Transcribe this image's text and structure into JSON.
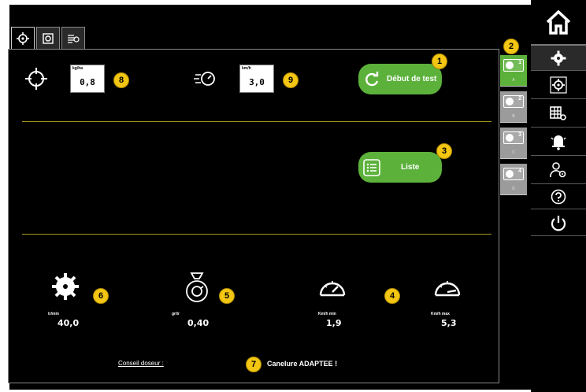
{
  "tabs": [
    {
      "name": "test-tab",
      "icon": "crosshair-icon",
      "active": true
    },
    {
      "name": "camera-tab",
      "icon": "photo-icon",
      "active": false
    },
    {
      "name": "brush-tab",
      "icon": "brush-icon",
      "active": false
    }
  ],
  "top_row": {
    "rate": {
      "unit": "kg/ha",
      "value": "0,8",
      "badge": "8"
    },
    "speed": {
      "unit": "km/h",
      "value": "3,0",
      "badge": "9"
    },
    "start_button": {
      "label": "Début de test",
      "badge": "1"
    }
  },
  "list_button": {
    "label": "Liste",
    "badge": "3"
  },
  "dose_strip": {
    "badge": "2",
    "items": [
      {
        "number": "1",
        "letter": "A",
        "active": true
      },
      {
        "number": "2",
        "letter": "B",
        "active": false
      },
      {
        "number": "3",
        "letter": "C",
        "active": false
      },
      {
        "number": "4",
        "letter": "D",
        "active": false
      }
    ]
  },
  "stats": {
    "trmin": {
      "label": "tr/min",
      "value": "40,0",
      "badge": "6"
    },
    "grtr": {
      "label": "gr/tr",
      "value": "0,40",
      "badge": "5"
    },
    "kmh_min": {
      "label": "Km/h min",
      "value": "1,9"
    },
    "kmh_max": {
      "label": "Km/h max",
      "value": "5,3"
    },
    "kmh_badge": "4"
  },
  "advice": {
    "label": "Conseil doseur :",
    "message": "Canelure ADAPTEE !",
    "badge": "7"
  },
  "colors": {
    "accent_green": "#5cb13b",
    "badge_yellow": "#f3c613",
    "divider_olive": "#a89a1c",
    "strip_grey": "#9b9b9b"
  },
  "sidebar": [
    "home-icon",
    "gear-icon",
    "crosshair-icon",
    "grid-settings-icon",
    "bell-icon",
    "user-settings-icon",
    "help-icon",
    "power-icon"
  ]
}
